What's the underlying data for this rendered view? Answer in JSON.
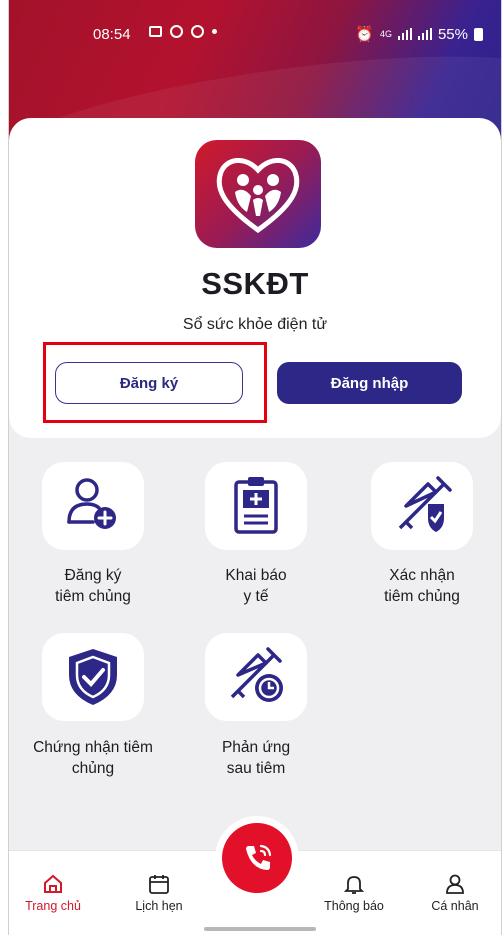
{
  "status_bar": {
    "time": "08:54",
    "network": "4G",
    "battery": "55%",
    "icons": [
      "gallery-icon",
      "shield-icon",
      "chat-icon",
      "dot",
      "alarm-icon",
      "signal-icon",
      "signal-icon",
      "battery-icon"
    ]
  },
  "app": {
    "title": "SSKĐT",
    "subtitle": "Sổ sức khỏe điện tử"
  },
  "auth": {
    "register_label": "Đăng ký",
    "login_label": "Đăng nhập"
  },
  "menu": {
    "items": [
      {
        "label_line1": "Đăng ký",
        "label_line2": "tiêm chủng",
        "icon": "add-user-icon"
      },
      {
        "label_line1": "Khai báo",
        "label_line2": "y tế",
        "icon": "clipboard-medical-icon"
      },
      {
        "label_line1": "Xác nhận",
        "label_line2": "tiêm chủng",
        "icon": "vaccine-check-icon"
      },
      {
        "label_line1": "Chứng nhận tiêm",
        "label_line2": "chủng",
        "icon": "shield-check-icon"
      },
      {
        "label_line1": "Phản ứng",
        "label_line2": "sau tiêm",
        "icon": "vaccine-clock-icon"
      }
    ]
  },
  "bottom_nav": {
    "items": [
      {
        "label": "Trang chủ",
        "icon": "home-icon",
        "active": true
      },
      {
        "label": "Lịch hẹn",
        "icon": "calendar-icon",
        "active": false
      },
      {
        "label": "Thông báo",
        "icon": "bell-icon",
        "active": false
      },
      {
        "label": "Cá nhân",
        "icon": "user-icon",
        "active": false
      }
    ],
    "call_icon": "phone-call-icon"
  },
  "colors": {
    "brand_red": "#e3102a",
    "brand_navy": "#2d2787",
    "highlight": "#e3000f",
    "background": "#efeff1"
  }
}
